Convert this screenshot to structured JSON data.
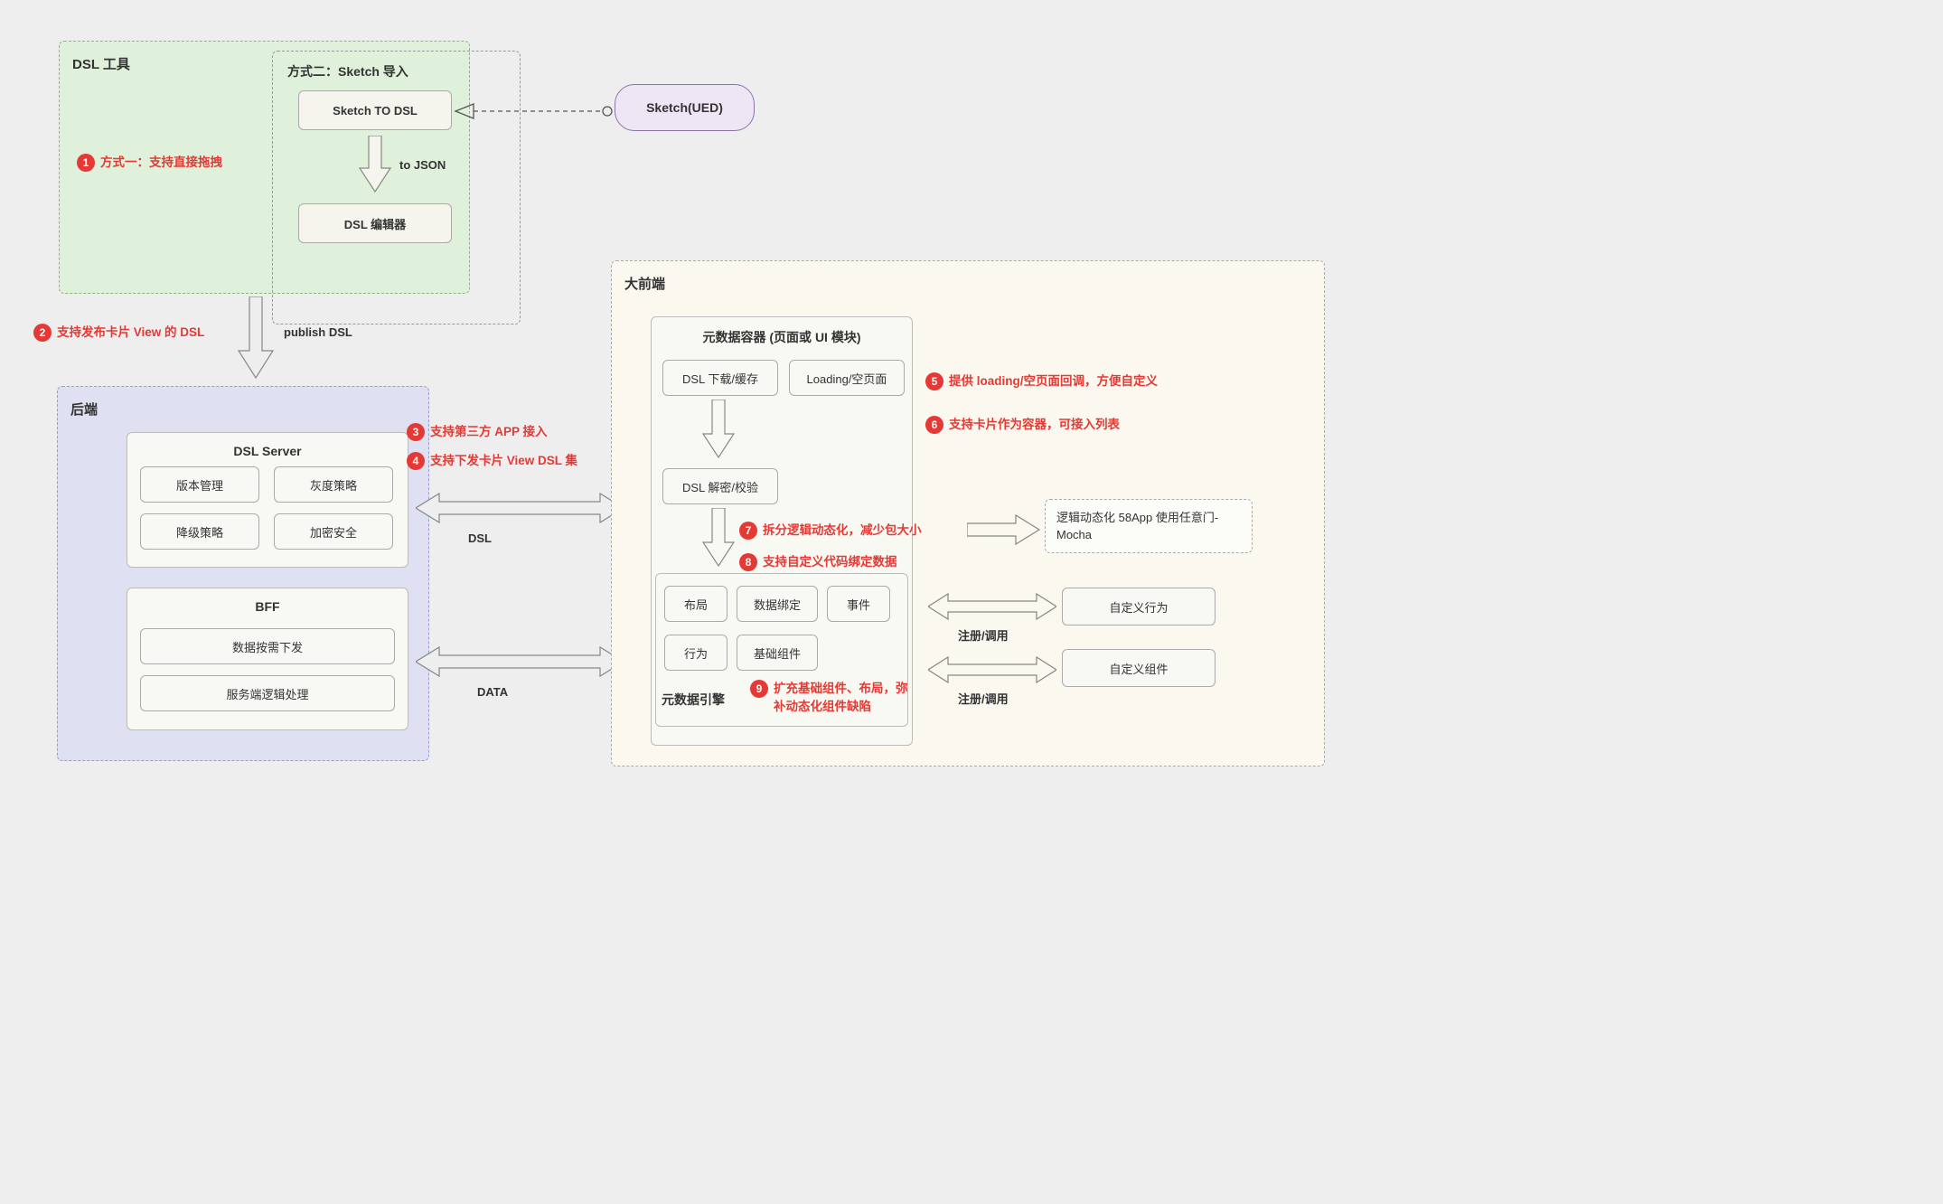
{
  "dsl_tool": {
    "title": "DSL 工具",
    "method2_title": "方式二：Sketch 导入",
    "sketch_to_dsl": "Sketch TO DSL",
    "to_json_label": "to JSON",
    "dsl_editor": "DSL 编辑器"
  },
  "sketch_ued": "Sketch(UED)",
  "publish_dsl_label": "publish DSL",
  "backend": {
    "title": "后端",
    "dsl_server": {
      "title": "DSL Server",
      "items": [
        "版本管理",
        "灰度策略",
        "降级策略",
        "加密安全"
      ]
    },
    "bff": {
      "title": "BFF",
      "items": [
        "数据按需下发",
        "服务端逻辑处理"
      ]
    }
  },
  "dsl_label": "DSL",
  "data_label": "DATA",
  "frontend": {
    "title": "大前端",
    "meta_container": {
      "title": "元数据容器 (页面或 UI 模块)",
      "dsl_download": "DSL 下载/缓存",
      "loading_empty": "Loading/空页面",
      "dsl_decrypt": "DSL 解密/校验",
      "engine_title": "元数据引擎",
      "engine_items": [
        "布局",
        "数据绑定",
        "事件",
        "行为",
        "基础组件"
      ]
    },
    "logic_dynamic": "逻辑动态化 58App 使用任意门-Mocha",
    "custom_behavior": "自定义行为",
    "custom_component": "自定义组件",
    "reg_call_1": "注册/调用",
    "reg_call_2": "注册/调用"
  },
  "annotations": {
    "a1": "方式一：支持直接拖拽",
    "a2": "支持发布卡片 View 的 DSL",
    "a3": "支持第三方 APP 接入",
    "a4": "支持下发卡片  View DSL 集",
    "a5": "提供 loading/空页面回调，方便自定义",
    "a6": "支持卡片作为容器，可接入列表",
    "a7": "拆分逻辑动态化，减少包大小",
    "a8": "支持自定义代码绑定数据",
    "a9": "扩充基础组件、布局，弥补动态化组件缺陷"
  }
}
